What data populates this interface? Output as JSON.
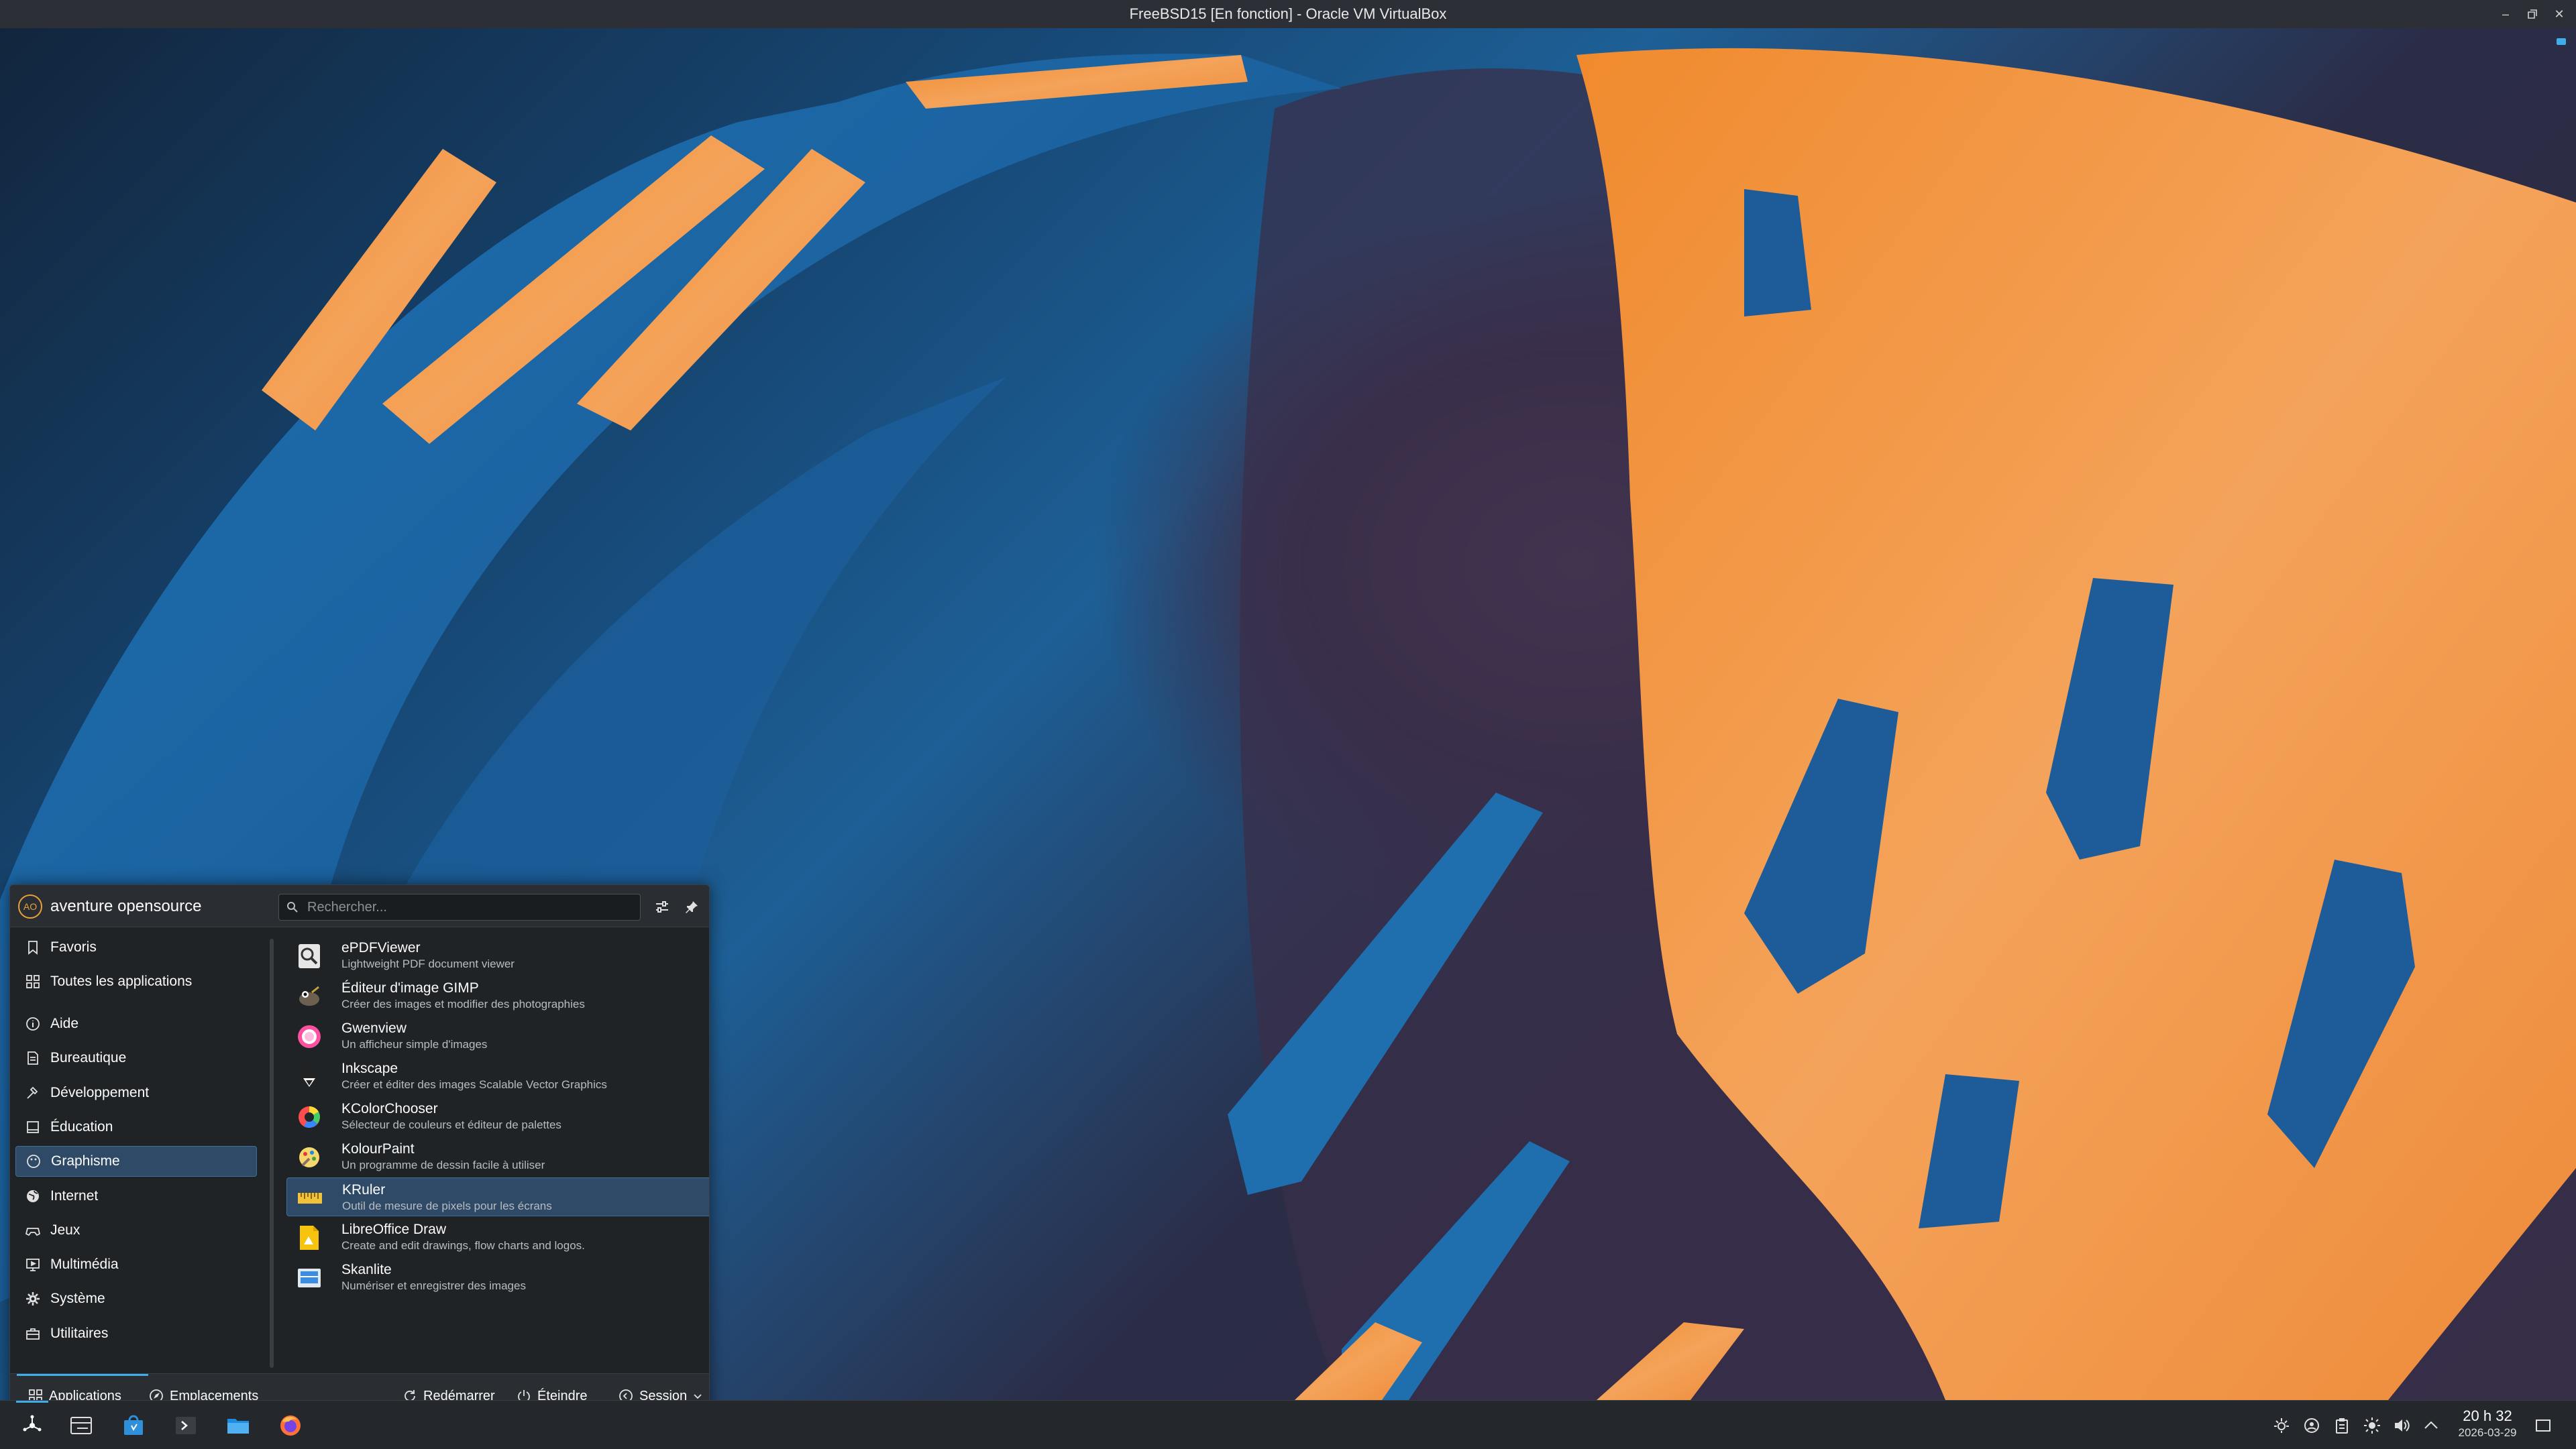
{
  "window": {
    "title": "FreeBSD15 [En fonction] - Oracle VM VirtualBox",
    "controls": [
      "minimize-icon",
      "restore-icon",
      "close-icon"
    ]
  },
  "launcher": {
    "user": {
      "initials": "AO",
      "name": "aventure opensource"
    },
    "search": {
      "placeholder": "Rechercher...",
      "value": ""
    },
    "categories": [
      {
        "label": "Favoris",
        "icon": "bookmark-icon"
      },
      {
        "label": "Toutes les applications",
        "icon": "grid-icon"
      },
      {
        "label": "Aide",
        "icon": "info-icon"
      },
      {
        "label": "Bureautique",
        "icon": "document-icon"
      },
      {
        "label": "Développement",
        "icon": "hammer-icon"
      },
      {
        "label": "Éducation",
        "icon": "book-icon"
      },
      {
        "label": "Graphisme",
        "icon": "palette-icon",
        "selected": true
      },
      {
        "label": "Internet",
        "icon": "globe-icon"
      },
      {
        "label": "Jeux",
        "icon": "gamepad-icon"
      },
      {
        "label": "Multimédia",
        "icon": "monitor-icon"
      },
      {
        "label": "Système",
        "icon": "gear-icon"
      },
      {
        "label": "Utilitaires",
        "icon": "toolbox-icon"
      }
    ],
    "apps": [
      {
        "name": "ePDFViewer",
        "description": "Lightweight PDF document viewer",
        "icon": "pdf-viewer-icon"
      },
      {
        "name": "Éditeur d'image GIMP",
        "description": "Créer des images et modifier des photographies",
        "icon": "gimp-icon"
      },
      {
        "name": "Gwenview",
        "description": "Un afficheur simple d'images",
        "icon": "gwenview-icon"
      },
      {
        "name": "Inkscape",
        "description": "Créer et éditer des images Scalable Vector Graphics",
        "icon": "inkscape-icon"
      },
      {
        "name": "KColorChooser",
        "description": "Sélecteur de couleurs et éditeur de palettes",
        "icon": "color-chooser-icon"
      },
      {
        "name": "KolourPaint",
        "description": "Un programme de dessin facile à utiliser",
        "icon": "kolourpaint-icon"
      },
      {
        "name": "KRuler",
        "description": "Outil de mesure de pixels pour les écrans",
        "icon": "ruler-icon",
        "selected": true
      },
      {
        "name": "LibreOffice Draw",
        "description": "Create and edit drawings, flow charts and logos.",
        "icon": "libreoffice-draw-icon"
      },
      {
        "name": "Skanlite",
        "description": "Numériser et enregistrer des images",
        "icon": "scanner-icon"
      }
    ],
    "footer": {
      "applications": "Applications",
      "places": "Emplacements",
      "restart": "Redémarrer",
      "shutdown": "Éteindre",
      "session": "Session"
    }
  },
  "taskbar": {
    "items": [
      "launcher-icon",
      "pager-icon",
      "software-store-icon",
      "terminal-icon",
      "file-manager-icon",
      "firefox-icon"
    ],
    "tray": [
      "network-icon",
      "updates-icon",
      "clipboard-icon",
      "brightness-icon",
      "volume-icon",
      "chevron-up-icon",
      "show-desktop-icon"
    ],
    "clock": {
      "time": "20 h 32",
      "date": "2026-03-29"
    }
  },
  "colors": {
    "accent": "#3daee9",
    "selection": "#2e4a66",
    "wallpaper_orange": "#f0913f",
    "wallpaper_blue": "#1d6fb5"
  }
}
